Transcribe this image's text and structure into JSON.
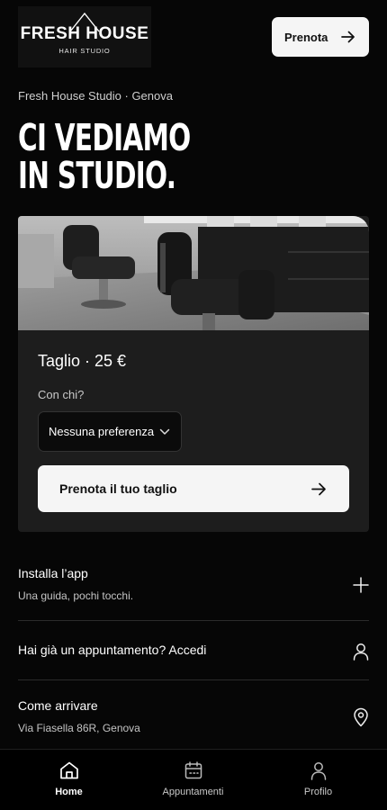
{
  "brand": {
    "name": "FRESH HOUSE",
    "sub": "HAIR STUDIO"
  },
  "header": {
    "book_label": "Prenota"
  },
  "location": "Fresh House Studio · Genova",
  "hero": {
    "line1": "CI VEDIAMO",
    "line2": "IN STUDIO."
  },
  "card": {
    "service": "Taglio · 25 €",
    "who_label": "Con chi?",
    "who_value": "Nessuna preferenza",
    "cta_label": "Prenota il tuo taglio"
  },
  "rows": [
    {
      "title": "Installa l’app",
      "subtitle": "Una guida, pochi tocchi.",
      "icon": "plus-icon"
    },
    {
      "title": "Hai già un appuntamento? Accedi",
      "subtitle": "",
      "icon": "user-icon"
    },
    {
      "title": "Come arrivare",
      "subtitle": "Via Fiasella 86R, Genova",
      "icon": "map-pin-icon"
    }
  ],
  "tabs": [
    {
      "label": "Home",
      "icon": "home-icon",
      "active": true
    },
    {
      "label": "Appuntamenti",
      "icon": "calendar-icon",
      "active": false
    },
    {
      "label": "Profilo",
      "icon": "user-icon",
      "active": false
    }
  ],
  "colors": {
    "background": "#060606",
    "card": "#1d1d1d",
    "button": "#f5f5f5",
    "text": "#ffffff"
  }
}
